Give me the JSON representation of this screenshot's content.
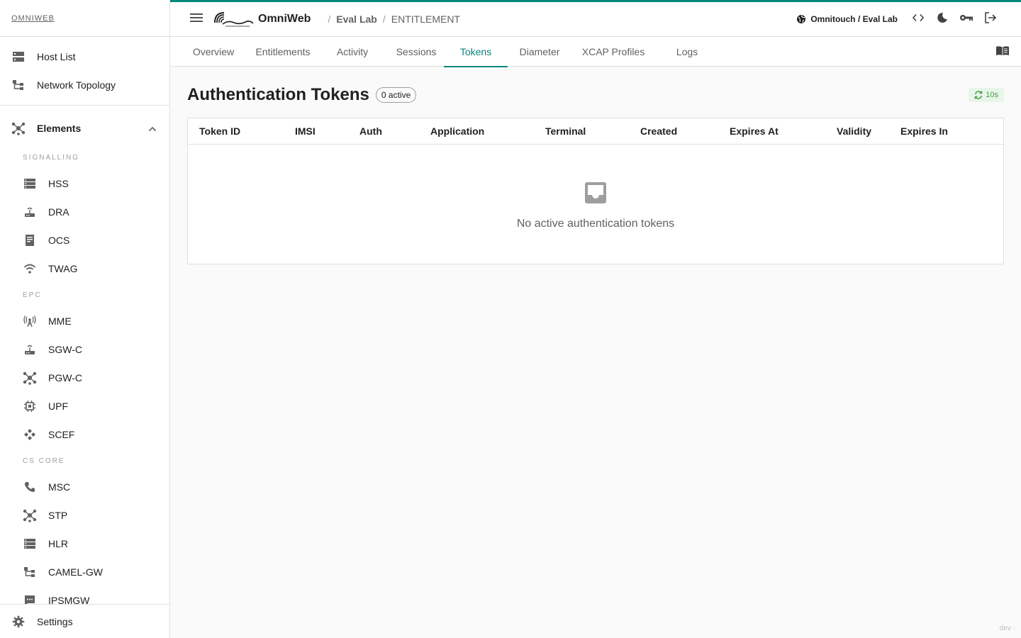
{
  "sidebar": {
    "brand": "OMNIWEB",
    "top_items": [
      {
        "label": "Host List",
        "icon": "server-icon"
      },
      {
        "label": "Network Topology",
        "icon": "topology-icon"
      }
    ],
    "group": {
      "label": "Elements",
      "icon": "hub-icon",
      "expanded": true
    },
    "sections": [
      {
        "label": "SIGNALLING",
        "items": [
          "HSS",
          "DRA",
          "OCS",
          "TWAG"
        ]
      },
      {
        "label": "EPC",
        "items": [
          "MME",
          "SGW-C",
          "PGW-C",
          "UPF",
          "SCEF"
        ]
      },
      {
        "label": "CS CORE",
        "items": [
          "MSC",
          "STP",
          "HLR",
          "CAMEL-GW",
          "IPSMGW"
        ]
      }
    ],
    "settings_label": "Settings"
  },
  "topbar": {
    "app_name": "OmniWeb",
    "breadcrumb_1": "Eval Lab",
    "breadcrumb_2": "ENTITLEMENT",
    "sep": "/",
    "tenant": "Omnitouch / Eval Lab",
    "accent": "#00897b"
  },
  "tabs": {
    "items": [
      "Overview",
      "Entitlements",
      "Activity",
      "Sessions",
      "Tokens",
      "Diameter",
      "XCAP Profiles",
      "Logs"
    ],
    "active": "Tokens"
  },
  "main": {
    "title": "Authentication Tokens",
    "count": "0 active",
    "refresh": "10s",
    "columns": [
      "Token ID",
      "IMSI",
      "Auth",
      "Application",
      "Terminal",
      "Created",
      "Expires At",
      "Validity",
      "Expires In"
    ],
    "empty_text": "No active authentication tokens"
  },
  "footer": "dev ·"
}
